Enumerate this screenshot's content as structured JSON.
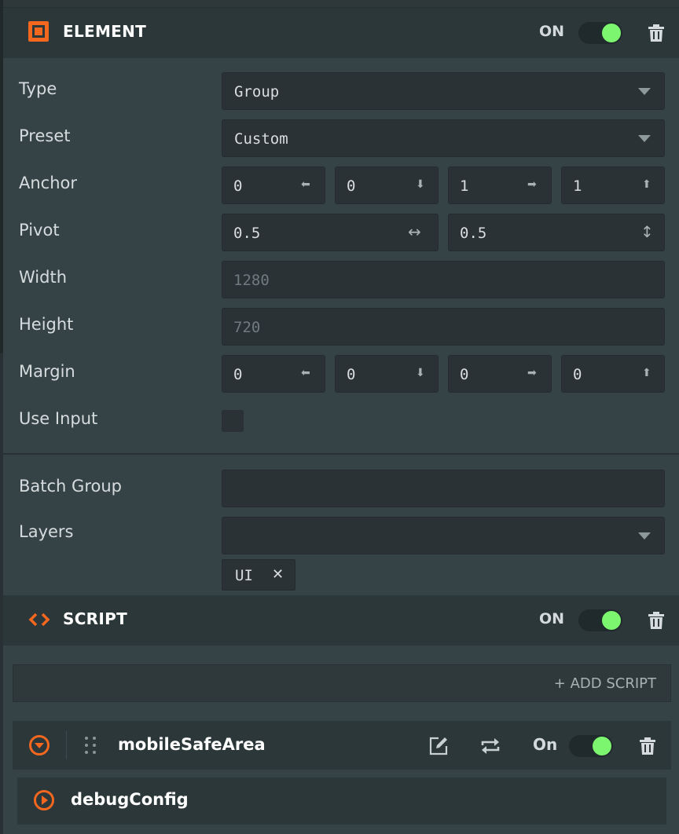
{
  "element_panel": {
    "title": "ELEMENT",
    "toggle_label": "ON",
    "toggle_on": true,
    "icon": "element-square-icon",
    "properties": {
      "type": {
        "label": "Type",
        "value": "Group"
      },
      "preset": {
        "label": "Preset",
        "value": "Custom"
      },
      "anchor": {
        "label": "Anchor",
        "values": [
          "0",
          "0",
          "1",
          "1"
        ]
      },
      "pivot": {
        "label": "Pivot",
        "values": [
          "0.5",
          "0.5"
        ]
      },
      "width": {
        "label": "Width",
        "placeholder": "1280"
      },
      "height": {
        "label": "Height",
        "placeholder": "720"
      },
      "margin": {
        "label": "Margin",
        "values": [
          "0",
          "0",
          "0",
          "0"
        ]
      },
      "use_input": {
        "label": "Use Input",
        "checked": false
      },
      "batch_group": {
        "label": "Batch Group",
        "value": ""
      },
      "layers": {
        "label": "Layers",
        "value": "",
        "tags": [
          "UI"
        ]
      }
    }
  },
  "script_panel": {
    "title": "SCRIPT",
    "toggle_label": "ON",
    "toggle_on": true,
    "icon": "code-brackets-icon",
    "add_script_label": "+ ADD SCRIPT",
    "scripts": [
      {
        "name": "mobileSafeArea",
        "expanded": true,
        "toggle_label": "On",
        "toggle_on": true
      },
      {
        "name": "debugConfig",
        "expanded": false
      }
    ]
  },
  "colors": {
    "accent": "#f4671f",
    "toggle_on": "#7cf56f",
    "panel_bg": "#364346",
    "header_bg": "#2c373a",
    "field_bg": "#2a3235"
  }
}
